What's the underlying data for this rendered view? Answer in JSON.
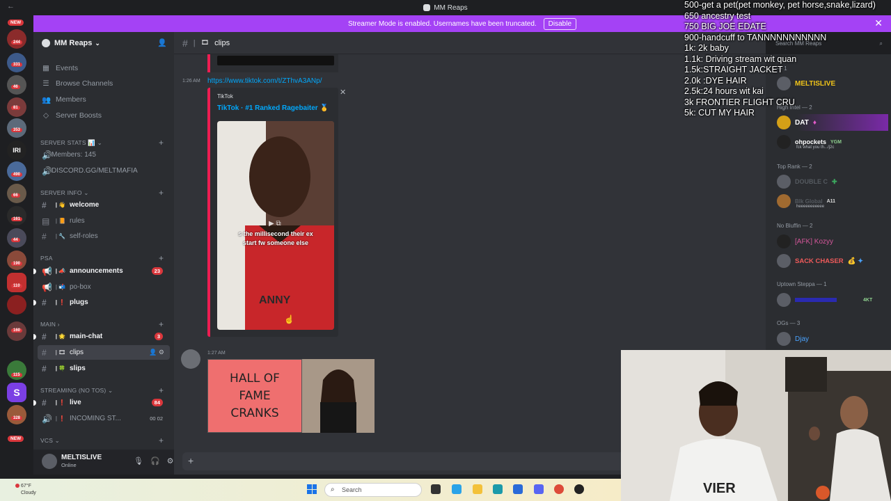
{
  "window": {
    "title": "MM Reaps",
    "back_icon": "back-arrow-icon"
  },
  "banner": {
    "text": "Streamer Mode is enabled. Usernames have been truncated.",
    "disable_label": "Disable",
    "close": "✕"
  },
  "server_rail": {
    "badges": [
      "NEW",
      "244",
      "331",
      "46",
      "81",
      "353",
      "IRI",
      "490",
      "66",
      "161",
      "44",
      "190",
      "110",
      "160",
      "115",
      "328",
      "NEW"
    ]
  },
  "sidebar": {
    "server_name": "MM Reaps",
    "nav": [
      "Events",
      "Browse Channels",
      "Members",
      "Server Boosts"
    ],
    "server_stats": {
      "label": "SERVER STATS",
      "members": "Members: 145",
      "invite": "DISCORD.GG/MELTMAFIA"
    },
    "server_info": {
      "label": "SERVER INFO",
      "channels": [
        "welcome",
        "rules",
        "self-roles"
      ]
    },
    "psa": {
      "label": "PSA",
      "channels": [
        "announcements",
        "po-box",
        "plugs"
      ],
      "announcements_count": "23"
    },
    "main": {
      "label": "MAIN",
      "channels": [
        "main-chat",
        "clips",
        "slips"
      ],
      "main_chat_count": "3"
    },
    "streaming": {
      "label": "STREAMING (NO TOS)",
      "channels": [
        "live",
        "INCOMING ST..."
      ],
      "live_count": "84",
      "incoming_counts": "00  02"
    },
    "vcs": {
      "label": "VCs"
    }
  },
  "user_panel": {
    "name": "MELTISLIVE",
    "status": "Online"
  },
  "chat": {
    "channel_name": "clips",
    "msg1_time": "1:26 AM",
    "link": "https://www.tiktok.com/t/ZThvA3ANp/",
    "embed_provider": "TikTok",
    "embed_title": "TikTok · #1 Ranked Ragebaiter 🥇",
    "embed_caption_line1": "s the millisecond their ex",
    "embed_caption_line2": "start fw someone else",
    "msg2_time": "1:27 AM",
    "hof_line1": "HALL OF",
    "hof_line2": "FAME",
    "hof_line3": "CRANKS"
  },
  "members": {
    "search_placeholder": "Search MM Reaps",
    "cat1": "— 1",
    "m1": "MELTISLIVE",
    "cat2": "High Intel — 2",
    "m2": "DAT",
    "m3": "ohpockets",
    "m3_tag": "YGM",
    "m3_sub": "fck what you th.../j2c",
    "cat3": "Top Rank — 2",
    "m4": "DOUBLE C",
    "m5": "Blk Global",
    "m5_tag": "A11",
    "m5_sub": "heeeeeeeeeee",
    "cat4": "No Bluffin — 2",
    "m6": "[AFK] Kozyy",
    "m7": "SACK CHASER",
    "cat5": "Uptown Steppa — 1",
    "m8_tag": "4KT",
    "cat6": "OGs — 3",
    "m9": "Djay"
  },
  "overlay_lines": [
    "500-get a pet(pet monkey, pet horse,snake,lizard)",
    "650 ancestry test",
    "750 BIG JOE EDATE",
    "900-handcuff to TANNNNNNNNNNN",
    "1k: 2k baby",
    "1.1k: Driving stream wit quan",
    "1.5k:STRAIGHT JACKET",
    "2.0k :DYE HAIR",
    "2.5k:24 hours wit kai",
    "3k FRONTIER FLIGHT CRU",
    "5k: CUT MY HAIR"
  ],
  "taskbar": {
    "temp": "67°F",
    "weather": "Cloudy",
    "search": "Search"
  },
  "colors": {
    "accent": "#a442f5",
    "link": "#00a8fc",
    "tiktok": "#ee1d52",
    "badge": "#da373c"
  }
}
